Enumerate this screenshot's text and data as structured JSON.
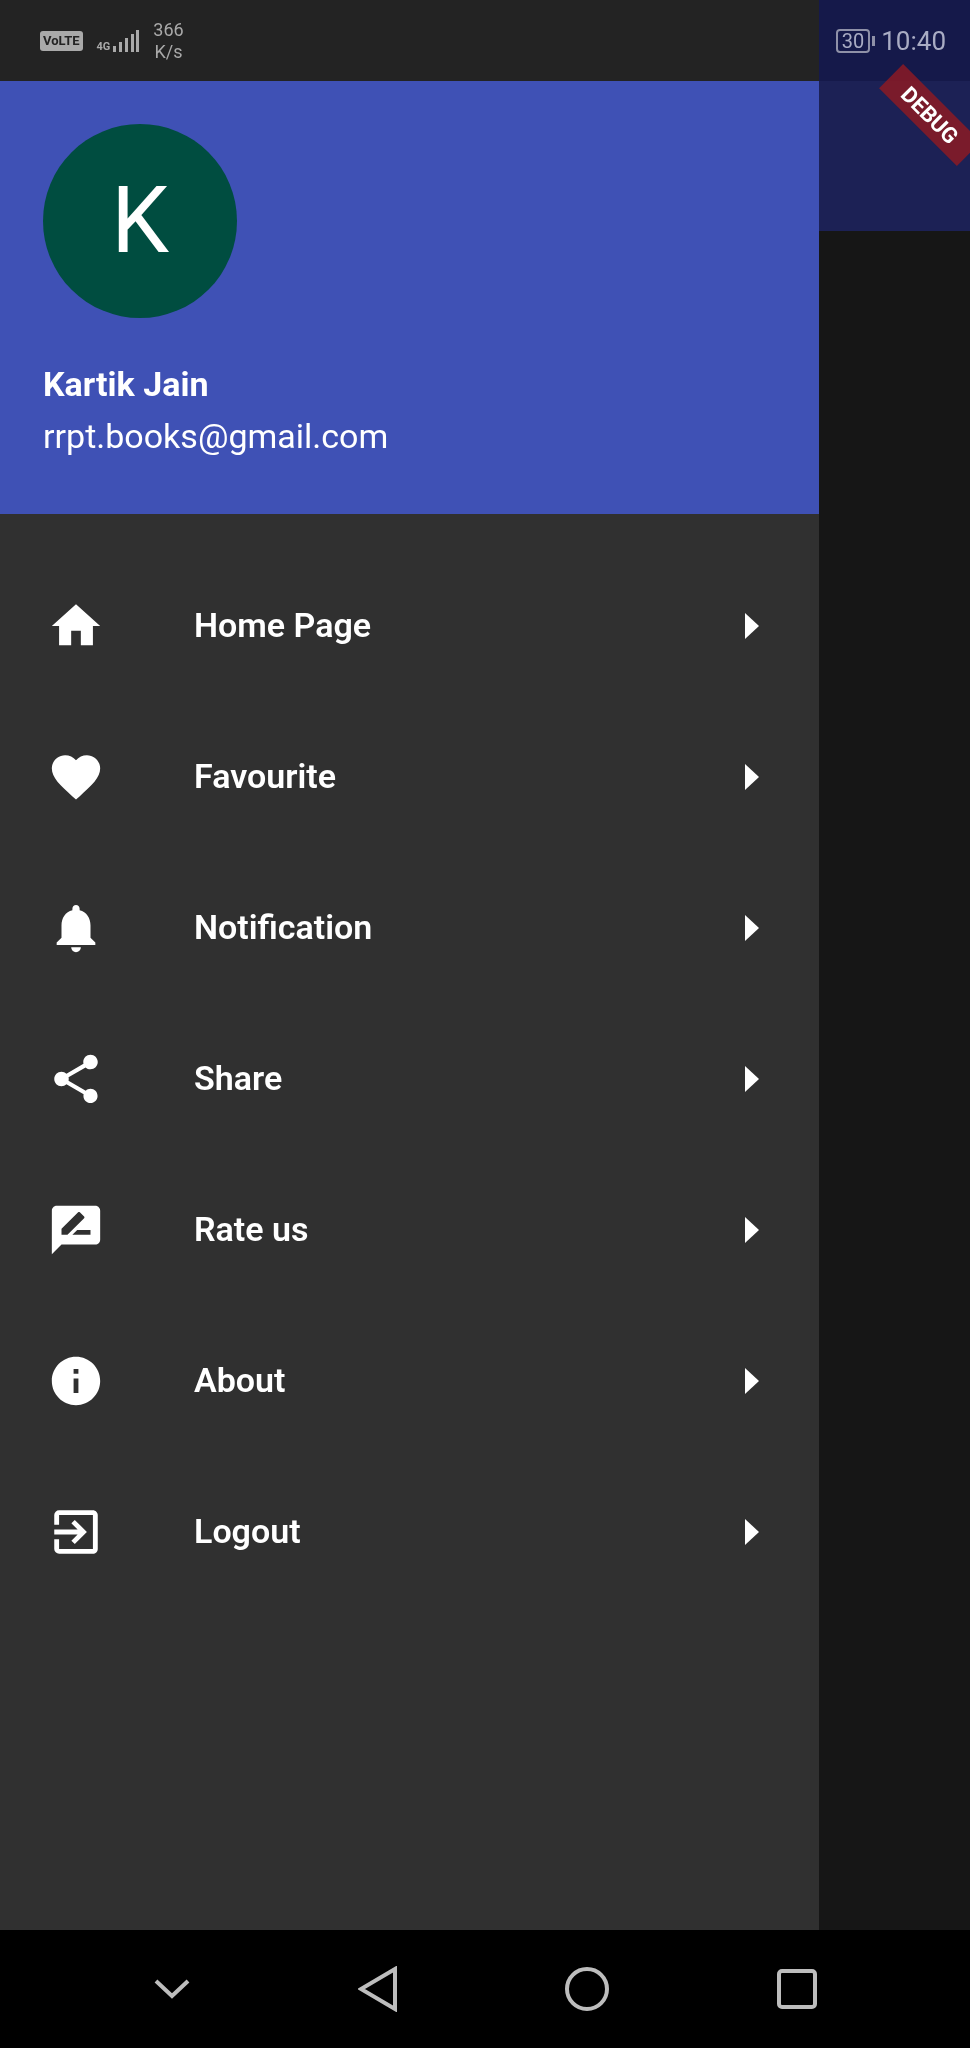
{
  "status_bar": {
    "volte": "VoLTE",
    "network": "4G",
    "speed": "366",
    "speed_unit": "K/s",
    "battery": "30",
    "time": "10:40"
  },
  "debug_banner": "DEBUG",
  "drawer": {
    "avatar_letter": "K",
    "name": "Kartik Jain",
    "email": "rrpt.books@gmail.com",
    "items": [
      {
        "label": "Home Page"
      },
      {
        "label": "Favourite"
      },
      {
        "label": "Notification"
      },
      {
        "label": "Share"
      },
      {
        "label": "Rate us"
      },
      {
        "label": "About"
      },
      {
        "label": "Logout"
      }
    ]
  }
}
